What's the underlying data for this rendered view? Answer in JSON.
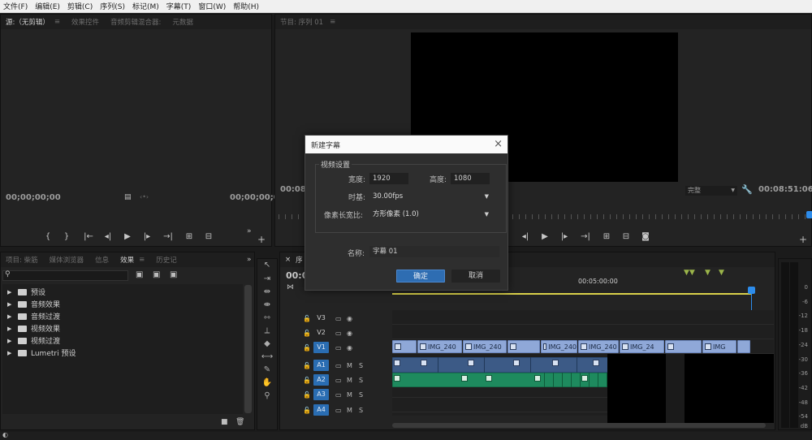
{
  "menu": [
    "文件(F)",
    "编辑(E)",
    "剪辑(C)",
    "序列(S)",
    "标记(M)",
    "字幕(T)",
    "窗口(W)",
    "帮助(H)"
  ],
  "source_panel": {
    "tabs": [
      "源:（无剪辑）",
      "效果控件",
      "音频剪辑混合器:",
      "元数据"
    ],
    "timecode_left": "00;00;00;00",
    "timecode_right": "00;00;00;0"
  },
  "program_panel": {
    "tab": "节目: 序列 01",
    "timecode_left": "00:08:",
    "zoom": "完整",
    "timecode_right": "00:08:51:06"
  },
  "project_panel": {
    "tabs": [
      "项目: 柴筋",
      "媒体浏览器",
      "信息",
      "效果",
      "历史记"
    ],
    "effects": [
      {
        "label": "预设",
        "type": "preset"
      },
      {
        "label": "音频效果",
        "type": "folder"
      },
      {
        "label": "音频过渡",
        "type": "folder"
      },
      {
        "label": "视频效果",
        "type": "folder"
      },
      {
        "label": "视频过渡",
        "type": "folder"
      },
      {
        "label": "Lumetri 预设",
        "type": "preset"
      }
    ]
  },
  "timeline": {
    "tab": "序",
    "timecode": "00:0",
    "ruler_mark": "00:05:00:00",
    "tracks": [
      {
        "name": "V3",
        "active": false,
        "type": "video"
      },
      {
        "name": "V2",
        "active": false,
        "type": "video"
      },
      {
        "name": "V1",
        "active": true,
        "type": "video"
      },
      {
        "name": "A1",
        "active": true,
        "type": "audio"
      },
      {
        "name": "A2",
        "active": true,
        "type": "audio"
      },
      {
        "name": "A3",
        "active": true,
        "type": "audio"
      },
      {
        "name": "A4",
        "active": true,
        "type": "audio"
      }
    ],
    "clip_label": "IMG_240",
    "clip_label_short": "IMG_24",
    "clip_label_tiny": "IMG"
  },
  "meter_scale": [
    "0",
    "-6",
    "-12",
    "-18",
    "-24",
    "-30",
    "-36",
    "-42",
    "-48",
    "-54",
    "dB"
  ],
  "dialog": {
    "title": "新建字幕",
    "group": "视频设置",
    "width_label": "宽度:",
    "width": "1920",
    "height_label": "高度:",
    "height": "1080",
    "timebase_label": "时基:",
    "timebase": "30.00fps",
    "par_label": "像素长宽比:",
    "par": "方形像素 (1.0)",
    "name_label": "名称:",
    "name": "字幕 01",
    "ok": "确定",
    "cancel": "取消"
  }
}
